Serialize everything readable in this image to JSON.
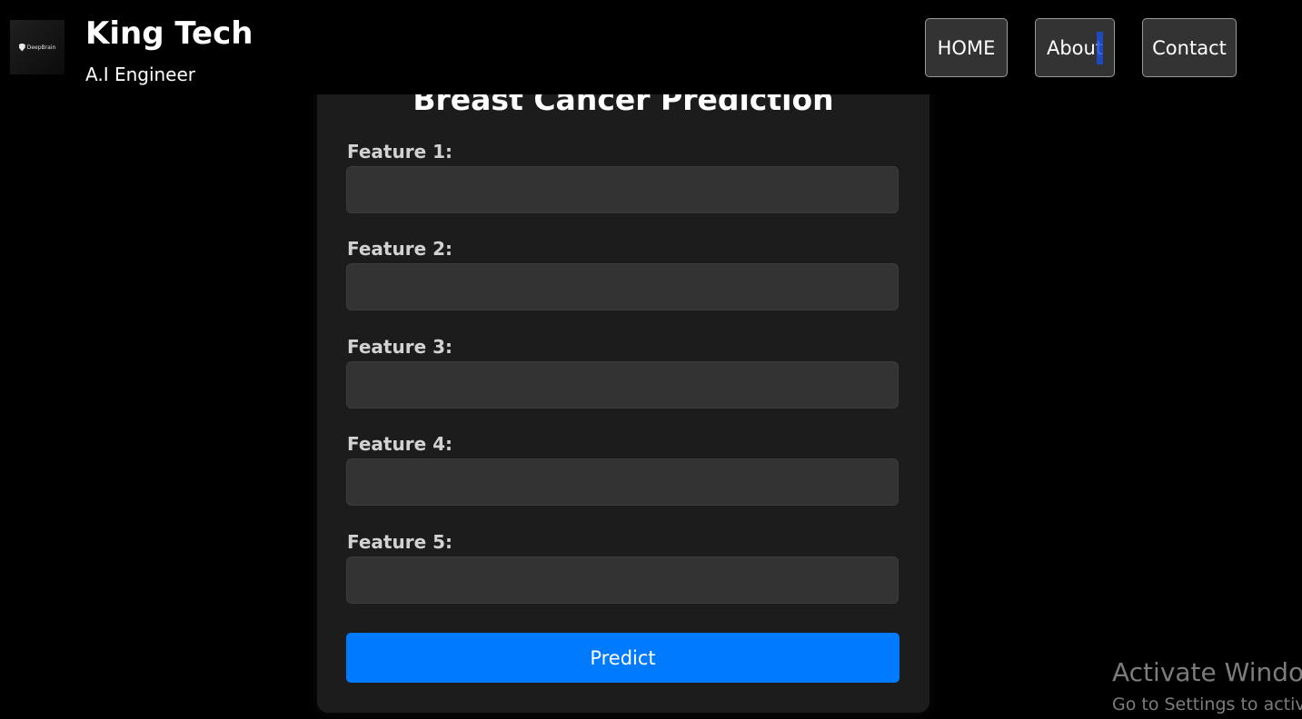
{
  "header": {
    "logo_text": "DeepBrain",
    "brand_title": "King Tech",
    "brand_subtitle": "A.I Engineer",
    "nav": [
      {
        "label": "HOME"
      },
      {
        "label": "About"
      },
      {
        "label": "Contact"
      }
    ]
  },
  "form": {
    "title": "Breast Cancer Prediction",
    "fields": [
      {
        "label": "Feature 1:",
        "value": "",
        "placeholder": ""
      },
      {
        "label": "Feature 2:",
        "value": "",
        "placeholder": ""
      },
      {
        "label": "Feature 3:",
        "value": "",
        "placeholder": ""
      },
      {
        "label": "Feature 4:",
        "value": "",
        "placeholder": ""
      },
      {
        "label": "Feature 5:",
        "value": "",
        "placeholder": ""
      }
    ],
    "submit_label": "Predict"
  },
  "watermark": {
    "title": "Activate Windows",
    "subtitle": "Go to Settings to activate Windows."
  },
  "colors": {
    "background": "#000000",
    "card": "#1c1c1c",
    "input": "#333333",
    "accent": "#007bff",
    "nav_button": "#333333"
  },
  "icons": {
    "logo": "deepbrain-logo"
  }
}
